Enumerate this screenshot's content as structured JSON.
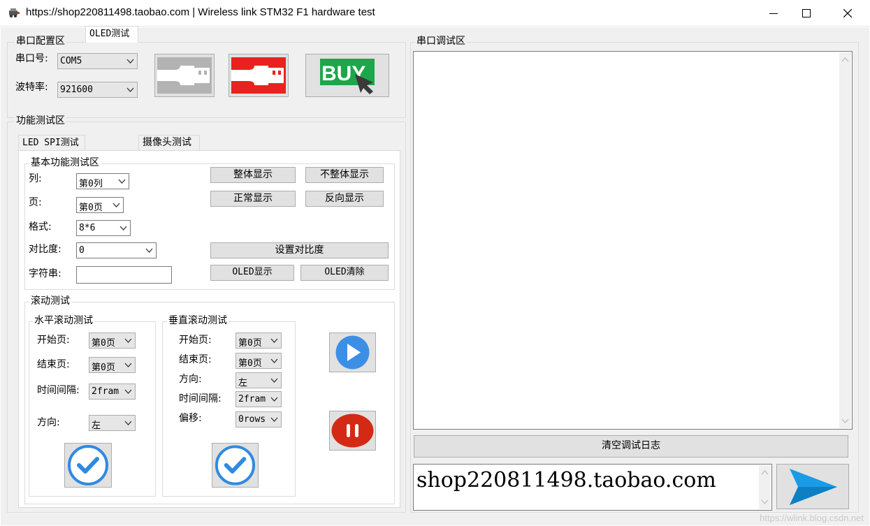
{
  "window": {
    "title": "https://shop220811498.taobao.com | Wireless link STM32 F1 hardware test",
    "icon": "app-icon",
    "controls": [
      "minimize-icon",
      "maximize-icon",
      "close-icon"
    ]
  },
  "serial_config": {
    "title": "串口配置区",
    "port_label": "串口号:",
    "port_value": "COM5",
    "baud_label": "波特率:",
    "baud_value": "921600",
    "buttons": [
      "usb-disconnected-icon",
      "usb-connect-icon",
      "buy-icon"
    ],
    "buy_text": "BUY"
  },
  "function_test": {
    "title": "功能测试区",
    "tabs": [
      {
        "label": "LED SPI测试"
      },
      {
        "label": "OLED测试"
      },
      {
        "label": "摄像头测试"
      }
    ],
    "basic": {
      "title": "基本功能测试区",
      "col_label": "列:",
      "col_value": "第0列",
      "page_label": "页:",
      "page_value": "第0页",
      "format_label": "格式:",
      "format_value": "8*6",
      "contrast_label": "对比度:",
      "contrast_value": "0",
      "string_label": "字符串:",
      "string_value": "",
      "btn_full": "整体显示",
      "btn_not_full": "不整体显示",
      "btn_normal": "正常显示",
      "btn_reverse": "反向显示",
      "btn_set_contrast": "设置对比度",
      "btn_oled_show": "OLED显示",
      "btn_oled_clear": "OLED清除"
    },
    "scroll": {
      "title": "滚动测试",
      "horizontal": {
        "title": "水平滚动测试",
        "start_label": "开始页:",
        "start_value": "第0页",
        "end_label": "结束页:",
        "end_value": "第0页",
        "interval_label": "时间间隔:",
        "interval_value": "2fram",
        "dir_label": "方向:",
        "dir_value": "左"
      },
      "vertical": {
        "title": "垂直滚动测试",
        "start_label": "开始页:",
        "start_value": "第0页",
        "end_label": "结束页:",
        "end_value": "第0页",
        "dir_label": "方向:",
        "dir_value": "左",
        "interval_label": "时间间隔:",
        "interval_value": "2fram",
        "offset_label": "偏移:",
        "offset_value": "0rows"
      }
    }
  },
  "debug": {
    "title": "串口调试区",
    "log_text": "",
    "clear_label": "清空调试日志",
    "input_value": "shop220811498.taobao.com",
    "send_icon": "send-icon"
  },
  "watermark": "https://wlink.blog.csdn.net",
  "colors": {
    "usb_red": "#e8231f",
    "buy_green": "#1fa64a",
    "play_blue": "#3d8fe6",
    "pause_red": "#d42a15",
    "check_blue": "#2f8ae0",
    "send_blue": "#1a9be6"
  }
}
